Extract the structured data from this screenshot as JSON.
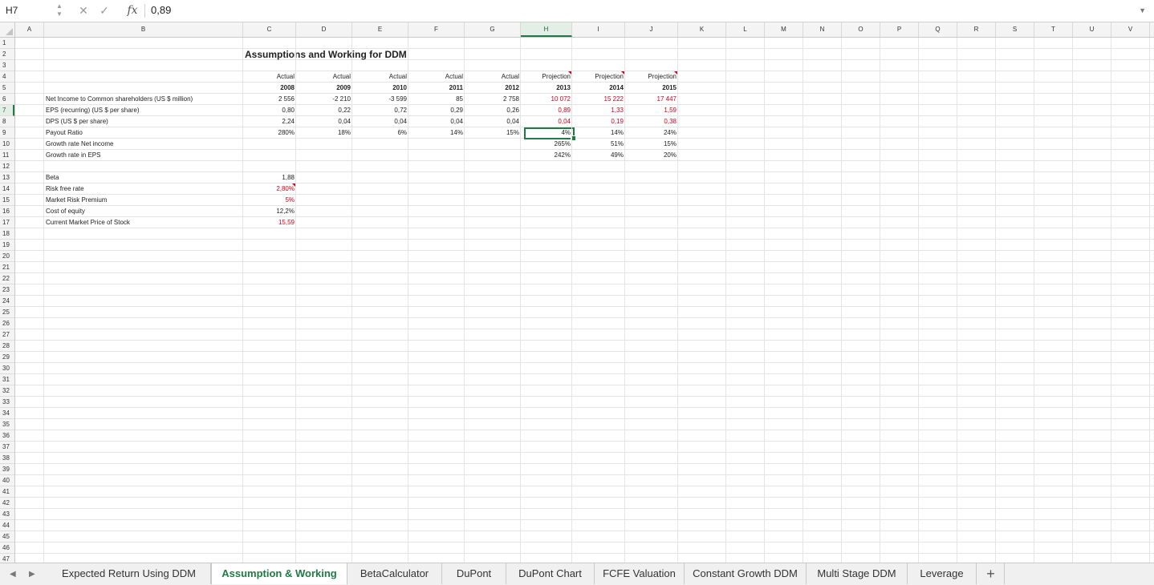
{
  "formula_bar": {
    "name_box": "H7",
    "value": "0,89",
    "icons": [
      "stepper-icon",
      "cancel-icon",
      "confirm-icon",
      "fx-icon",
      "expand-icon"
    ]
  },
  "columns": [
    "A",
    "B",
    "C",
    "D",
    "E",
    "F",
    "G",
    "H",
    "I",
    "J",
    "K",
    "L",
    "M",
    "N",
    "O",
    "P",
    "Q",
    "R",
    "S",
    "T",
    "U",
    "V"
  ],
  "selected_column": "H",
  "rows": [
    "1",
    "2",
    "3",
    "4",
    "5",
    "6",
    "7",
    "8",
    "9",
    "10",
    "11",
    "12",
    "13",
    "14",
    "15",
    "16",
    "17",
    "18",
    "19",
    "20",
    "21",
    "22",
    "23",
    "24",
    "25",
    "26",
    "27",
    "28",
    "29",
    "30",
    "31",
    "32",
    "33",
    "34",
    "35",
    "36",
    "37",
    "38",
    "39",
    "40",
    "41",
    "42",
    "43",
    "44",
    "45",
    "46",
    "47"
  ],
  "selected_row": "7",
  "sheet": {
    "title": "Assumptions and Working for DDM",
    "header_type": [
      "Actual",
      "Actual",
      "Actual",
      "Actual",
      "Actual",
      "Projection",
      "Projection",
      "Projection"
    ],
    "header_year": [
      "2008",
      "2009",
      "2010",
      "2011",
      "2012",
      "2013",
      "2014",
      "2015"
    ],
    "labels": {
      "net_income": "Net Income to Common shareholders  (US $ million)",
      "eps": "EPS (recurring) (US $ per share)",
      "dps": "DPS (US $ per share)",
      "payout": "Payout Ratio",
      "growth_ni": "Growth rate Net income",
      "growth_eps": "Growth rate in EPS",
      "beta": "Beta",
      "rf": "Risk free rate",
      "mrp": "Market Risk Premium",
      "coe": "Cost of equity",
      "price": "Current Market Price of Stock"
    },
    "net_income": [
      "2 556",
      "-2 210",
      "-3 599",
      "85",
      "2 758",
      "10 072",
      "15 222",
      "17 447"
    ],
    "eps": [
      "0,80",
      "0,22",
      "0,72",
      "0,29",
      "0,26",
      "0,89",
      "1,33",
      "1,59"
    ],
    "dps": [
      "2,24",
      "0,04",
      "0,04",
      "0,04",
      "0,04",
      "0,04",
      "0,19",
      "0,38"
    ],
    "payout": [
      "280%",
      "18%",
      "6%",
      "14%",
      "15%",
      "4%",
      "14%",
      "24%"
    ],
    "growth_ni": [
      "265%",
      "51%",
      "15%"
    ],
    "growth_eps": [
      "242%",
      "49%",
      "20%"
    ],
    "beta": "1,88",
    "rf": "2,80%",
    "mrp": "5%",
    "coe": "12,2%",
    "price": "15,59"
  },
  "tabs": [
    "Expected Return Using DDM",
    "Assumption & Working",
    "BetaCalculator",
    "DuPont",
    "DuPont Chart",
    "FCFE Valuation",
    "Constant Growth DDM",
    "Multi Stage DDM",
    "Leverage"
  ],
  "active_tab": "Assumption & Working",
  "colors": {
    "accent": "#1f7a45",
    "input_red": "#d0021b"
  }
}
